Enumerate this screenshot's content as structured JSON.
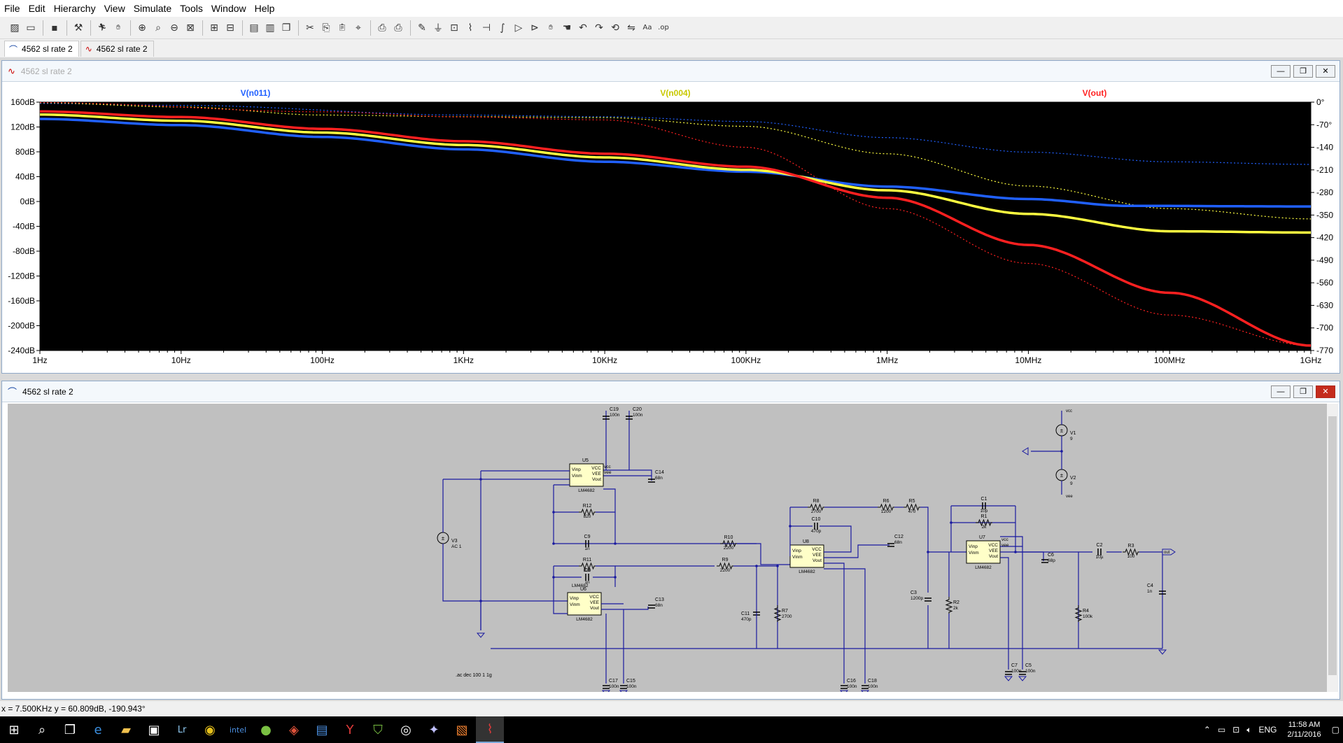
{
  "menu": [
    "File",
    "Edit",
    "Hierarchy",
    "View",
    "Simulate",
    "Tools",
    "Window",
    "Help"
  ],
  "tabs": [
    {
      "label": "4562  sl rate 2",
      "icon": "schematic-icon"
    },
    {
      "label": "4562  sl rate 2",
      "icon": "waveform-icon"
    }
  ],
  "plot_window": {
    "title": "4562  sl rate 2"
  },
  "schematic_window": {
    "title": "4562  sl rate 2"
  },
  "chart_data": {
    "type": "line",
    "traces": [
      {
        "name": "V(n011)",
        "color": "#2060ff"
      },
      {
        "name": "V(n004)",
        "color": "#ffff40"
      },
      {
        "name": "V(out)",
        "color": "#ff2020"
      }
    ],
    "x_ticks": [
      "1Hz",
      "10Hz",
      "100Hz",
      "1KHz",
      "10KHz",
      "100KHz",
      "1MHz",
      "10MHz",
      "100MHz",
      "1GHz"
    ],
    "x_scale": "log",
    "x_range": [
      1,
      1000000000
    ],
    "y_ticks": [
      "160dB",
      "120dB",
      "80dB",
      "40dB",
      "0dB",
      "-40dB",
      "-80dB",
      "-120dB",
      "-160dB",
      "-200dB",
      "-240dB"
    ],
    "y_range": [
      -240,
      160
    ],
    "y2_ticks": [
      "0°",
      "-70°",
      "-140°",
      "-210°",
      "-280°",
      "-350°",
      "-420°",
      "-490°",
      "-560°",
      "-630°",
      "-700°",
      "-770°"
    ],
    "y2_range": [
      -770,
      0
    ],
    "background": "#000000",
    "magnitude": {
      "V(n011)": [
        [
          1,
          133
        ],
        [
          10,
          123
        ],
        [
          100,
          104
        ],
        [
          1000,
          84
        ],
        [
          10000,
          64
        ],
        [
          100000,
          48
        ],
        [
          1000000,
          24
        ],
        [
          10000000,
          4
        ],
        [
          50000000,
          -7
        ],
        [
          1000000000,
          -8
        ]
      ],
      "V(n004)": [
        [
          1,
          140
        ],
        [
          10,
          130
        ],
        [
          100,
          111
        ],
        [
          1000,
          91
        ],
        [
          10000,
          71
        ],
        [
          100000,
          51
        ],
        [
          1000000,
          18
        ],
        [
          10000000,
          -20
        ],
        [
          100000000,
          -48
        ],
        [
          1000000000,
          -50
        ]
      ],
      "V(out)": [
        [
          1,
          145
        ],
        [
          10,
          136
        ],
        [
          100,
          117
        ],
        [
          1000,
          97
        ],
        [
          10000,
          77
        ],
        [
          100000,
          56
        ],
        [
          1000000,
          6
        ],
        [
          10000000,
          -70
        ],
        [
          100000000,
          -147
        ],
        [
          1000000000,
          -232
        ]
      ]
    },
    "phase": {
      "V(n011)": [
        [
          1,
          -4
        ],
        [
          10,
          -10
        ],
        [
          1000,
          -40
        ],
        [
          10000,
          -45
        ],
        [
          100000,
          -60
        ],
        [
          1000000,
          -110
        ],
        [
          10000000,
          -155
        ],
        [
          100000000,
          -185
        ],
        [
          1000000000,
          -193
        ]
      ],
      "V(n004)": [
        [
          1,
          -2
        ],
        [
          10,
          -15
        ],
        [
          100,
          -40
        ],
        [
          1000,
          -45
        ],
        [
          10000,
          -48
        ],
        [
          100000,
          -75
        ],
        [
          1000000,
          -160
        ],
        [
          10000000,
          -260
        ],
        [
          100000000,
          -330
        ],
        [
          1000000000,
          -362
        ]
      ],
      "V(out)": [
        [
          1,
          -1
        ],
        [
          100,
          -30
        ],
        [
          1000,
          -46
        ],
        [
          10000,
          -55
        ],
        [
          100000,
          -140
        ],
        [
          1000000,
          -330
        ],
        [
          10000000,
          -500
        ],
        [
          100000000,
          -660
        ],
        [
          1000000000,
          -755
        ]
      ]
    }
  },
  "schematic": {
    "labels": {
      "U5": "U5",
      "U6": "U6",
      "U7": "U7",
      "U8": "U8",
      "part": "LM4682",
      "V1": "V1",
      "V2": "V2",
      "V3": "V3",
      "V3val": "AC 1",
      "V1val": "9",
      "V2val": "9",
      "vcc": "vcc",
      "vee": "vee",
      "out": "out",
      "C19": "C19",
      "C19v": "100n",
      "C20": "C20",
      "C20v": "100n",
      "C14": "C14",
      "C14v": "68n",
      "C13": "C13",
      "C13v": "68n",
      "C12": "C12",
      "C12v": "68n",
      "C6": "C6",
      "C6v": "68p",
      "R12": "R12",
      "R12v": "820",
      "R11": "R11",
      "R11v": "820",
      "C9": "C9",
      "C9v": "1n",
      "C8": "C8",
      "C8v": "1n",
      "R10": "R10",
      "R10v": "2200",
      "R9": "R9",
      "R9v": "2200",
      "R8": "R8",
      "R8v": "2700",
      "R7": "R7",
      "R7v": "2700",
      "C10": "C10",
      "C10v": "470p",
      "C11": "C11",
      "C11v": "470p",
      "R6": "R6",
      "R6v": "1200",
      "R5": "R5",
      "R5v": "470",
      "C3": "C3",
      "C3v": "1200p",
      "R2": "R2",
      "R2v": "2k",
      "R1": "R1",
      "R1v": "2k",
      "C1": "C1",
      "C1v": "10p",
      "C2": "C2",
      "C2v": "10µ",
      "R3": "R3",
      "R3v": "100",
      "R4": "R4",
      "R4v": "100k",
      "C4": "C4",
      "C4v": "1n",
      "C17": "C17",
      "C17v": "100n",
      "C15": "C15",
      "C15v": "100n",
      "C16": "C16",
      "C16v": "100n",
      "C18": "C18",
      "C18v": "100n",
      "C7": "C7",
      "C7v": "100n",
      "C5": "C5",
      "C5v": "100n",
      "pin_vinp": "Vinp",
      "pin_vinm": "Vinm",
      "pin_vcc": "VCC",
      "pin_vee": "VEE",
      "pin_vout": "Vout",
      "directive": ".ac dec 100 1 1g"
    }
  },
  "status": "x = 7.500KHz    y = 60.809dB, -190.943°",
  "clock": {
    "time": "11:58 AM",
    "date": "2/11/2016"
  },
  "tray_lang": "ENG"
}
